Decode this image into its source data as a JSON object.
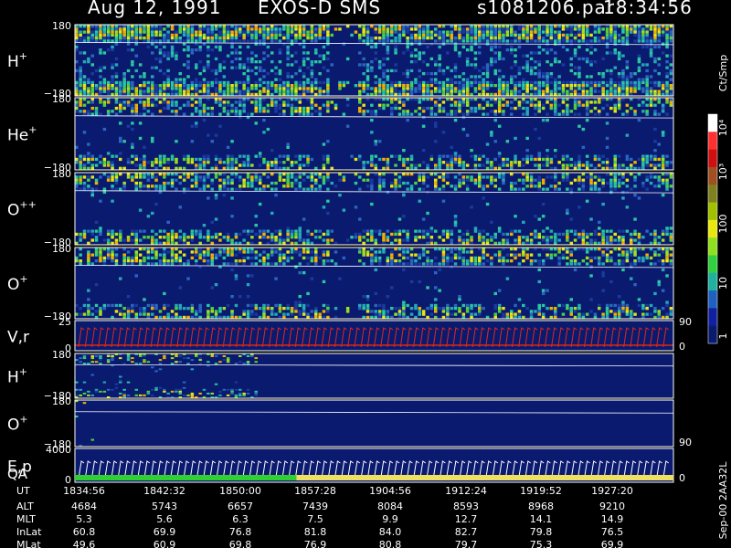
{
  "header": {
    "date": "Aug 12, 1991",
    "instrument": "EXOS-D SMS",
    "file": "s1081206.par",
    "time": "18:34:56"
  },
  "colors": {
    "background": "#000000",
    "panel_fill": "#0a1a6e",
    "vr_trace": "#e02818",
    "ep_trace": "#ffffff"
  },
  "chart_data": {
    "type": "heatmap",
    "panels": [
      {
        "species": "H",
        "charge": "+",
        "ymax": "180",
        "ymin": "−180",
        "activity": 0.85
      },
      {
        "species": "He",
        "charge": "+",
        "ymax": "180",
        "ymin": "−180",
        "activity": 0.55
      },
      {
        "species": "O",
        "charge": "++",
        "ymax": "180",
        "ymin": "−180",
        "activity": 0.55
      },
      {
        "species": "O",
        "charge": "+",
        "ymax": "180",
        "ymin": "−180",
        "activity": 0.55
      },
      {
        "species": "V,r",
        "charge": "",
        "ymax": "25",
        "ymin": "0",
        "right_top": "90",
        "right_bottom": "0",
        "line": true
      },
      {
        "species": "H",
        "charge": "+",
        "ymax": "180",
        "ymin": "−180",
        "activity": 0.35
      },
      {
        "species": "O",
        "charge": "+",
        "ymax": "180",
        "ymin": "−180",
        "activity": 0.05,
        "right_bottom": "90"
      },
      {
        "species": "E,p",
        "charge": "",
        "ymax": "4000",
        "ymin": "0",
        "right_bottom": "0",
        "line": true
      }
    ],
    "qa_label": "QA",
    "qa_segments": [
      {
        "from": 0.0,
        "to": 0.37,
        "color": "#30d030"
      },
      {
        "from": 0.37,
        "to": 1.0,
        "color": "#f0e060"
      }
    ],
    "colorbar": {
      "unit": "Ct/Smp",
      "ticks": [
        "1",
        "10",
        "100",
        "10³",
        "10⁴"
      ]
    },
    "ephemeris": {
      "labels": [
        "UT",
        "ALT",
        "MLT",
        "InLat",
        "MLat"
      ],
      "columns": [
        [
          "1834:56",
          "4684",
          "5.3",
          "60.8",
          "49.6"
        ],
        [
          "1842:32",
          "5743",
          "5.6",
          "69.9",
          "60.9"
        ],
        [
          "1850:00",
          "6657",
          "6.3",
          "76.8",
          "69.8"
        ],
        [
          "1857:28",
          "7439",
          "7.5",
          "81.8",
          "76.9"
        ],
        [
          "1904:56",
          "8084",
          "9.9",
          "84.0",
          "80.8"
        ],
        [
          "1912:24",
          "8593",
          "12.7",
          "82.7",
          "79.7"
        ],
        [
          "1919:52",
          "8968",
          "14.1",
          "79.8",
          "75.3"
        ],
        [
          "1927:20",
          "9210",
          "14.9",
          "76.5",
          "69.9"
        ]
      ]
    },
    "footer_note": "Sep-00 2AA32L"
  }
}
